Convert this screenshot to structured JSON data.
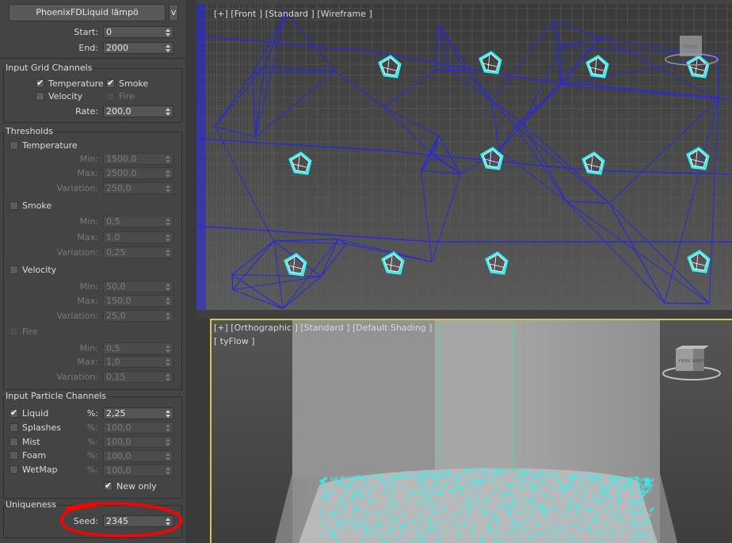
{
  "object": {
    "name": "PhoenixFDLiquid lämpö",
    "more_button": "v"
  },
  "frames": {
    "start_label": "Start:",
    "start_value": "0",
    "end_label": "End:",
    "end_value": "2000"
  },
  "grid_channels": {
    "title": "Input Grid Channels",
    "temperature": {
      "label": "Temperature",
      "checked": true
    },
    "smoke": {
      "label": "Smoke",
      "checked": true
    },
    "velocity": {
      "label": "Velocity",
      "checked": false
    },
    "fire": {
      "label": "Fire",
      "checked": false
    },
    "rate_label": "Rate:",
    "rate_value": "200,0"
  },
  "thresholds": {
    "title": "Thresholds",
    "min_label": "Min:",
    "max_label": "Max:",
    "variation_label": "Variation:",
    "temperature": {
      "label": "Temperature",
      "min": "1500,0",
      "max": "2500,0",
      "variation": "250,0"
    },
    "smoke": {
      "label": "Smoke",
      "min": "0,5",
      "max": "1,0",
      "variation": "0,25"
    },
    "velocity": {
      "label": "Velocity",
      "min": "50,0",
      "max": "150,0",
      "variation": "25,0"
    },
    "fire": {
      "label": "Fire",
      "min": "0,5",
      "max": "1,0",
      "variation": "0,15"
    }
  },
  "particle_channels": {
    "title": "Input Particle Channels",
    "pct_label": "%:",
    "liquid": {
      "label": "Liquid",
      "checked": true,
      "value": "2,25"
    },
    "splashes": {
      "label": "Splashes",
      "checked": false,
      "value": "100,0"
    },
    "mist": {
      "label": "Mist",
      "checked": false,
      "value": "100,0"
    },
    "foam": {
      "label": "Foam",
      "checked": false,
      "value": "100,0"
    },
    "wetmap": {
      "label": "WetMap",
      "checked": false,
      "value": "100,0"
    },
    "new_only": {
      "label": "New only",
      "checked": true
    }
  },
  "uniqueness": {
    "title": "Uniqueness",
    "seed_label": "Seed:",
    "seed_value": "2345"
  },
  "viewport_top": {
    "label": "[+] [Front ] [Standard ] [Wireframe ]",
    "gizmo": "front"
  },
  "viewport_bottom": {
    "label": "[+] [Orthographic ] [Standard ] [Default Shading ]",
    "sub_label": "[ tyFlow ]",
    "gizmo_front": "FRON",
    "gizmo_right": "RIGHT"
  },
  "colors": {
    "wire_blue": "#2a2ad8",
    "particle_cyan": "#37f0f0",
    "annotation_red": "#ff0000",
    "active_viewport": "#d5c55a"
  }
}
